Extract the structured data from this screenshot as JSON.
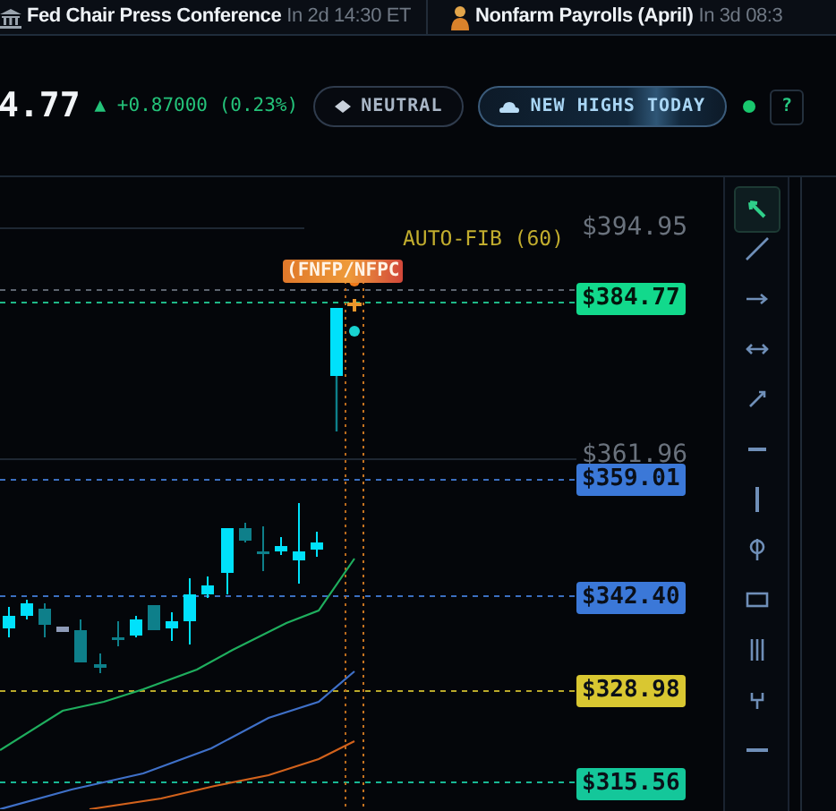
{
  "ticker": [
    {
      "kind": "bank",
      "title": "Fed Chair Press Conference",
      "time": "In 2d 14:30 ET"
    },
    {
      "kind": "person",
      "title": "Nonfarm Payrolls (April)",
      "time": "In 3d 08:3"
    }
  ],
  "quote": {
    "price": "4.77",
    "arrow": "▲",
    "change": "+0.87000 (0.23%)"
  },
  "badges": [
    {
      "kind": "neutral",
      "label": "NEUTRAL"
    },
    {
      "kind": "highs",
      "label": "NEW HIGHS TODAY"
    }
  ],
  "help_button": "?",
  "chart": {
    "fib_label": "AUTO-FIB (60)",
    "event_marker": "(FNFP/NFPC",
    "axis_labels": [
      "$394.95",
      "$361.96"
    ],
    "price_tags": [
      {
        "text": "$384.77",
        "color": "#12d98c"
      },
      {
        "text": "$359.01",
        "color": "#3b78d8"
      },
      {
        "text": "$342.40",
        "color": "#3b78d8"
      },
      {
        "text": "$328.98",
        "color": "#d9c731"
      },
      {
        "text": "$315.56",
        "color": "#14c79a"
      }
    ]
  },
  "tools": [
    {
      "kind": "cursor",
      "selected": true
    },
    {
      "kind": "trend-line",
      "selected": false
    },
    {
      "kind": "arrow",
      "selected": false
    },
    {
      "kind": "double-arrow",
      "selected": false
    },
    {
      "kind": "ray",
      "selected": false
    },
    {
      "kind": "horizontal-line",
      "selected": false
    },
    {
      "kind": "vertical-line",
      "selected": false
    },
    {
      "kind": "fib",
      "selected": false
    },
    {
      "kind": "rectangle",
      "selected": false
    },
    {
      "kind": "bars",
      "selected": false
    },
    {
      "kind": "fork",
      "selected": false
    },
    {
      "kind": "dash",
      "selected": false
    }
  ]
}
